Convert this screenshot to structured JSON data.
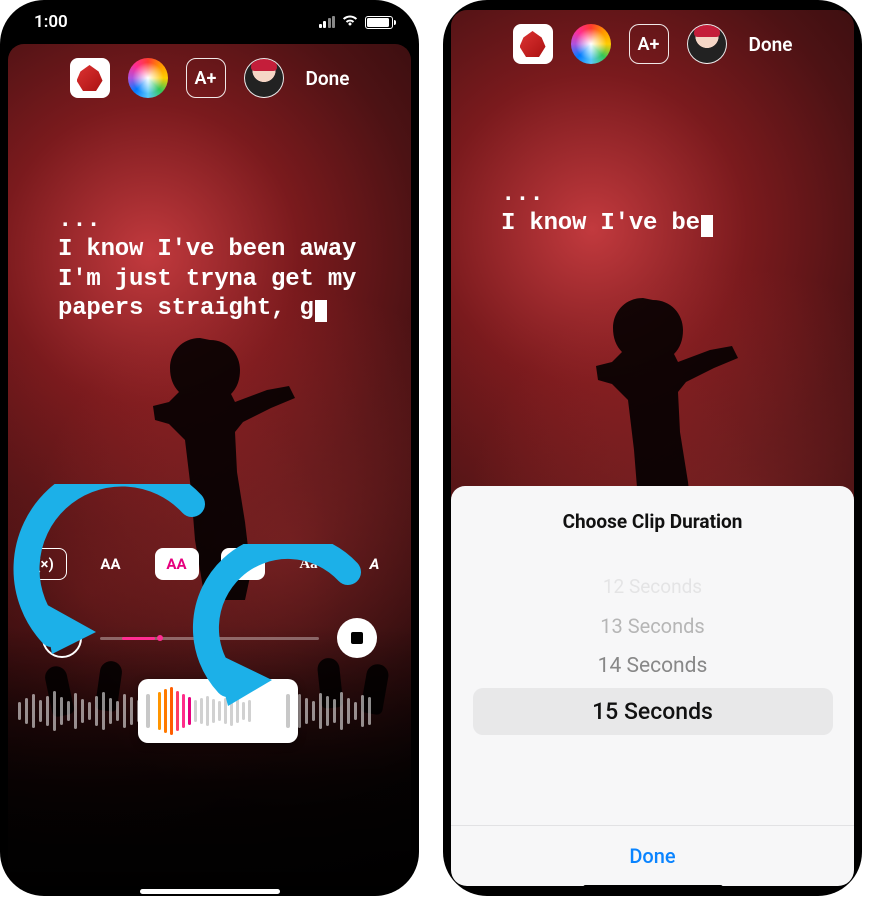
{
  "status": {
    "time": "1:00"
  },
  "toolbar": {
    "text_button_label": "A+",
    "done_label": "Done"
  },
  "lyrics_left": {
    "ellipsis": "...",
    "line1": "I know I've been away",
    "line2": "I'm just tryna get my papers straight, g"
  },
  "lyrics_right": {
    "ellipsis": "...",
    "partial": "I know I've be"
  },
  "font_row": {
    "a1": "AA",
    "a2": "AA",
    "a3": "A",
    "a4": "Aa"
  },
  "duration": {
    "value": "15"
  },
  "sheet": {
    "title": "Choose Clip Duration",
    "options": [
      "12 Seconds",
      "13 Seconds",
      "14 Seconds",
      "15 Seconds"
    ],
    "done": "Done"
  }
}
